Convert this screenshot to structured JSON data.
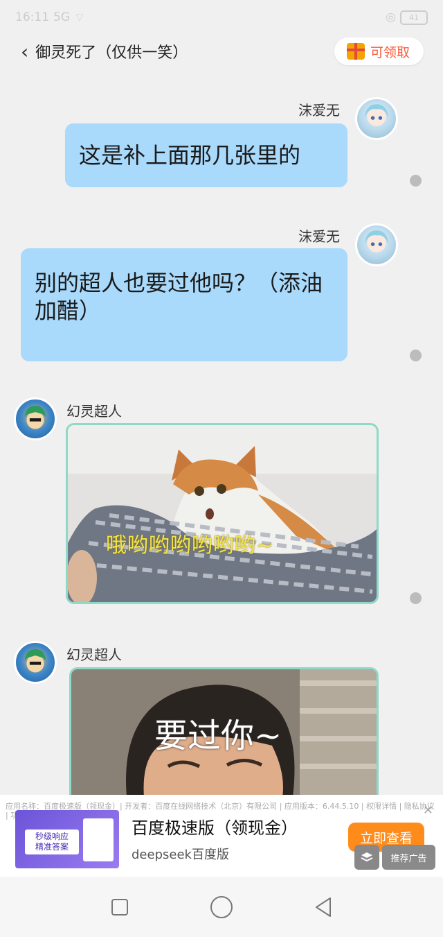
{
  "status_bar": {
    "time": "16:11",
    "network": "5G",
    "battery": "41"
  },
  "header": {
    "back_icon": "chevron-left-icon",
    "title": "御灵死了（仅供一笑）",
    "claim_label": "可领取",
    "claim_icon": "gift-icon"
  },
  "messages": [
    {
      "sender": "沫爱无",
      "type": "text",
      "text": "这是补上面那几张里的"
    },
    {
      "sender": "沫爱无",
      "type": "text",
      "text": "别的超人也要过他吗？（添油加醋）"
    },
    {
      "sender": "幻灵超人",
      "type": "image",
      "caption": "哦哟哟哟哟哟哟~"
    },
    {
      "sender": "幻灵超人",
      "type": "image",
      "caption": "要过你~"
    }
  ],
  "ad": {
    "meta": "应用名称：百度极速版（领现金）| 开发者：百度在线网络技术（北京）有限公司 | 应用版本：6.44.5.10 | 权限详情 | 隐私协议 | 功能介绍",
    "thumb_line1": "秒级响应",
    "thumb_line2": "精准答案",
    "title": "百度极速版（领现金）",
    "subtitle": "deepseek百度版",
    "cta": "立即查看",
    "tag": "推荐广告",
    "close_icon": "close-icon",
    "logo_icon": "layers-icon"
  },
  "nav": {
    "recent_icon": "square-icon",
    "home_icon": "circle-icon",
    "back_icon": "triangle-back-icon"
  },
  "colors": {
    "bubble": "#a9d9fb",
    "image_border": "#8fd9c8",
    "accent": "#ff5b3c",
    "cta": "#ff8c1a"
  }
}
